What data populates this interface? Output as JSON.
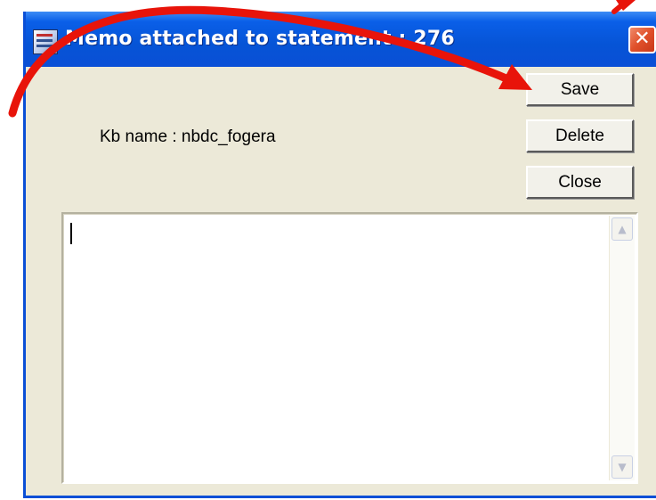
{
  "window": {
    "title": "Memo attached to statement :  276",
    "close_glyph": "✕"
  },
  "kb": {
    "label": "Kb name :  nbdc_fogera"
  },
  "buttons": {
    "save": "Save",
    "delete": "Delete",
    "close": "Close"
  },
  "memo": {
    "value": ""
  },
  "icons": {
    "app": "app-icon",
    "scroll_up": "scroll-up-icon",
    "scroll_down": "scroll-down-icon"
  },
  "colors": {
    "titlebar": "#0a54d6",
    "dialog_bg": "#ece9d8",
    "annotation_arrow": "#e8140a",
    "close_button": "#e0502a"
  }
}
